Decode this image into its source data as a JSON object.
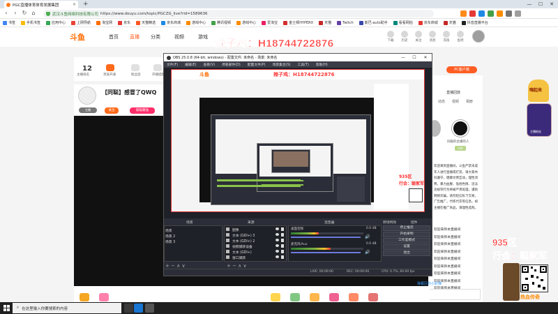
{
  "browser": {
    "tab_title": "PGC直播体育体育发展集团",
    "new_tab_symbol": "+",
    "window_controls": [
      "—",
      "☐",
      "✕"
    ],
    "back_symbol": "‹",
    "forward_symbol": "›",
    "reload_symbol": "↻",
    "home_symbol": "⌂",
    "url_org": "武汉斗鱼网络科技有限公司",
    "url": "https://www.douyu.com/topic/PGCZG_live?rid=1589636",
    "bookmarks": [
      "书签",
      "手机书签",
      "应用中心",
      "上网导航",
      "淘宝网",
      "京东",
      "天猫精选",
      "京东商城",
      "游戏中心",
      "腾讯视频",
      "游戏中心",
      "爱淘宝",
      "金士顿HYPERX",
      "天猫",
      "Twitch",
      "斯巴-auto助手",
      "看看网拍",
      "京东商城",
      "天猫",
      "抖音直播平台"
    ]
  },
  "site": {
    "logo": "斗鱼",
    "nav": [
      "首页",
      "直播",
      "分类",
      "视频",
      "游戏"
    ],
    "active_nav": "直播",
    "header_icons": [
      "下载",
      "历史",
      "关注",
      "消息",
      "充值",
      "鱼吧"
    ]
  },
  "watermark": "辣子鸡：H18744722876",
  "rank": {
    "number": "12",
    "label": "主播排名",
    "extra_labels": [
      "贵族开通",
      "粉丝团",
      "开播提醒"
    ]
  },
  "room": {
    "title": "【同聪】感冒了QWQ",
    "follow_label": "关注",
    "badge_label": "聪聪最强",
    "tag_label": "主播"
  },
  "right_panel": {
    "pc_button": "PC客户端",
    "title": "直播回放",
    "tabs": [
      "动态",
      "视频",
      "相册"
    ],
    "user_label": "同聪的主播的人",
    "level": "LV8",
    "desc": [
      "欢迎来到直播间，斗鱼严禁未成年人进行直播或打赏，请大家共同遵守，健康文明互动，理性消费，暴力血腥、低俗色情、违法违规等行为将被严肃处理，谨防网络诈骗，请勿轻信私下交易，广告推广，代练代充等信息。如主播在推广商品，请理性选购。"
    ],
    "chat": [
      "欢迎来到本直播间",
      "欢迎来到本直播间",
      "欢迎来到本直播间",
      "欢迎来到本直播间",
      "欢迎来到本直播间",
      "欢迎来到本直播间",
      "欢迎来到本直播间",
      "欢迎来到本直播间",
      "欢迎来到本直播间",
      "欢迎来到本直播间"
    ],
    "chat_input_hint": "弹幕区的小彩弹",
    "big_badge": "嗨起来",
    "big_avatar_label": "主播粉丝"
  },
  "overlay": {
    "server": "935区",
    "guild": "行会：聪家军",
    "logo": "热血传奇"
  },
  "obs": {
    "title": "OBS 25.0.8 (64-bit, windows) - 配置文件: 未命名 - 场景: 未命名",
    "menus": [
      "文件(F)",
      "编辑(E)",
      "查看(V)",
      "停靠部件(D)",
      "配置文件(P)",
      "场景集合(S)",
      "工具(T)",
      "帮助(H)"
    ],
    "dock_titles": [
      "场景",
      "来源",
      "混音器",
      "转场特效",
      "控件"
    ],
    "scenes": [
      "场景",
      "场景 2",
      "场景 3"
    ],
    "sources": [
      "图像",
      "文本 (GDI+) 3",
      "文本 (GDI+) 2",
      "视频捕获设备",
      "文本 (GDI+)",
      "窗口捕获"
    ],
    "mixer": [
      {
        "name": "桌面音频",
        "level": 0.38,
        "db": "0.0 dB"
      },
      {
        "name": "麦克风/Aux",
        "level": 0.55,
        "db": "0.0 dB"
      }
    ],
    "controls": [
      "停止推流",
      "开始录制",
      "工作室模式",
      "设置",
      "退出"
    ],
    "dock_tools": "+  −  ∧  ∨",
    "status": [
      "LIVE: 00:00:00",
      "REC: 00:00:00",
      "CPU: 0.7%, 60.00 fps"
    ]
  },
  "taskbar": {
    "search_placeholder": "在这里输入你要搜索的内容"
  }
}
